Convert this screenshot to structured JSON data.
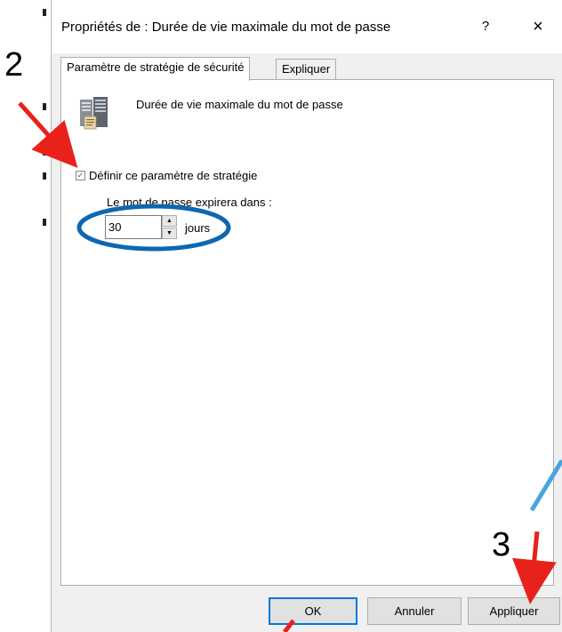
{
  "dialog": {
    "title": "Propriétés de : Durée de vie maximale du mot de passe",
    "help_glyph": "?",
    "close_glyph": "×",
    "tabs": [
      {
        "label": "Paramètre de stratégie de sécurité",
        "active": true
      },
      {
        "label": "Expliquer",
        "active": false
      }
    ],
    "policy_icon": "server-policy-icon",
    "policy_name": "Durée de vie maximale du mot de passe",
    "define_checkbox": {
      "label": "Définir ce paramètre de stratégie",
      "checked": true,
      "glyph": "✓"
    },
    "expire_label": "Le mot de passe expirera dans :",
    "expire_value": "30",
    "spin_up_glyph": "▲",
    "spin_down_glyph": "▼",
    "unit": "jours",
    "buttons": {
      "ok": "OK",
      "cancel": "Annuler",
      "apply": "Appliquer"
    }
  },
  "annotations": {
    "step2": "2",
    "step3": "3",
    "arrow_color": "#e8211a",
    "ellipse_color": "#0d67b0",
    "cyan_line_color": "#4aa3df"
  }
}
